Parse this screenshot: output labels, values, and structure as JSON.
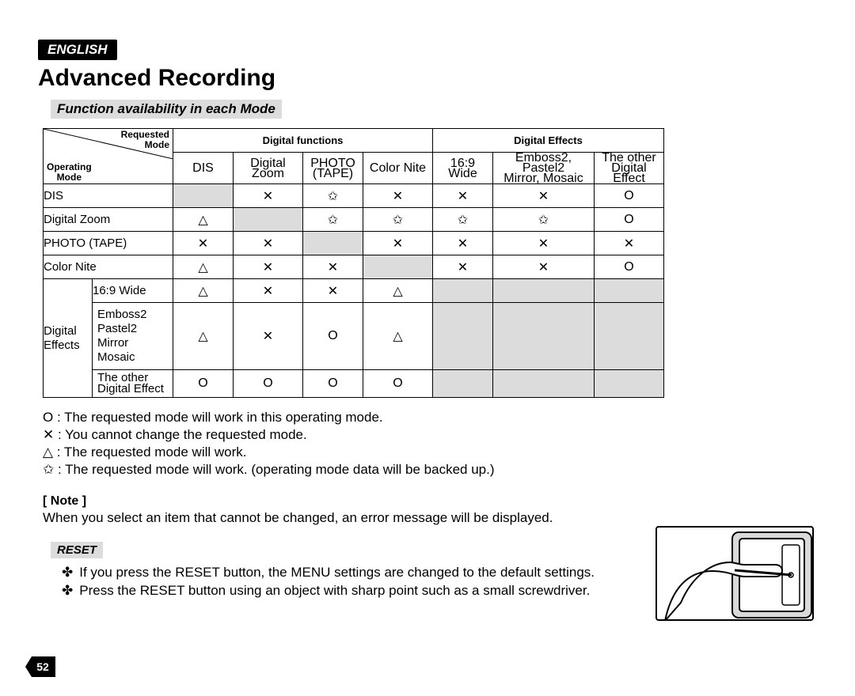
{
  "lang": "ENGLISH",
  "title": "Advanced Recording",
  "subhead": "Function availability in each Mode",
  "corner": {
    "requested": "Requested",
    "mode": "Mode",
    "operating": "Operating",
    "modeRow": "Mode"
  },
  "groupHeaders": {
    "digitalFunctions": "Digital functions",
    "digitalEffects": "Digital Effects"
  },
  "cols": {
    "dis": "DIS",
    "dzoom": "Digital Zoom",
    "photo1": "PHOTO",
    "photo2": "(TAPE)",
    "colorNite": "Color Nite",
    "wide1": "16:9",
    "wide2": "Wide",
    "emb1": "Emboss2, Pastel2",
    "emb2": "Mirror, Mosaic",
    "other1": "The other",
    "other2": "Digital Effect"
  },
  "rows": {
    "dis": "DIS",
    "dzoom": "Digital Zoom",
    "photo": "PHOTO (TAPE)",
    "colorNite": "Color Nite",
    "group": "Digital Effects",
    "wide": "16:9 Wide",
    "emb_l1": "Emboss2",
    "emb_l2": "Pastel2",
    "emb_l3": "Mirror",
    "emb_l4": "Mosaic",
    "other_l1": "The other",
    "other_l2": "Digital Effect"
  },
  "sym": {
    "o": "O",
    "x": "✕",
    "tri": "△",
    "star": "✩"
  },
  "chart_data": {
    "type": "table",
    "row_labels": [
      "DIS",
      "Digital Zoom",
      "PHOTO (TAPE)",
      "Color Nite",
      "16:9 Wide",
      "Emboss2/Pastel2/Mirror/Mosaic",
      "The other Digital Effect"
    ],
    "col_labels": [
      "DIS",
      "Digital Zoom",
      "PHOTO (TAPE)",
      "Color Nite",
      "16:9 Wide",
      "Emboss2,Pastel2,Mirror,Mosaic",
      "The other Digital Effect"
    ],
    "cells": [
      [
        "shaded",
        "✕",
        "✩",
        "✕",
        "✕",
        "✕",
        "O"
      ],
      [
        "△",
        "shaded",
        "✩",
        "✩",
        "✩",
        "✩",
        "O"
      ],
      [
        "✕",
        "✕",
        "shaded",
        "✕",
        "✕",
        "✕",
        "✕"
      ],
      [
        "△",
        "✕",
        "✕",
        "shaded",
        "✕",
        "✕",
        "O"
      ],
      [
        "△",
        "✕",
        "✕",
        "△",
        "shaded",
        "shaded",
        "shaded"
      ],
      [
        "△",
        "✕",
        "O",
        "△",
        "shaded",
        "shaded",
        "shaded"
      ],
      [
        "O",
        "O",
        "O",
        "O",
        "shaded",
        "shaded",
        "shaded"
      ]
    ],
    "legend": {
      "O": "works in this operating mode",
      "✕": "cannot change",
      "△": "will work",
      "✩": "will work, operating data backed up",
      "shaded": "n/a (same mode or grouped)"
    }
  },
  "legend": {
    "o": "O  : The requested mode will work in this operating mode.",
    "x": "✕ : You cannot change the requested mode.",
    "tri": "△ : The requested mode will work.",
    "star": "✩ : The requested mode will work. (operating mode data will be backed up.)"
  },
  "note": {
    "head": "[ Note ]",
    "body": "When you select an item that cannot be changed, an error message will be displayed."
  },
  "reset": {
    "head": "RESET",
    "b1": "If you press the RESET button, the MENU settings are changed to the default settings.",
    "b2": "Press the RESET button using an object with sharp point such as a small screwdriver."
  },
  "page": "52"
}
